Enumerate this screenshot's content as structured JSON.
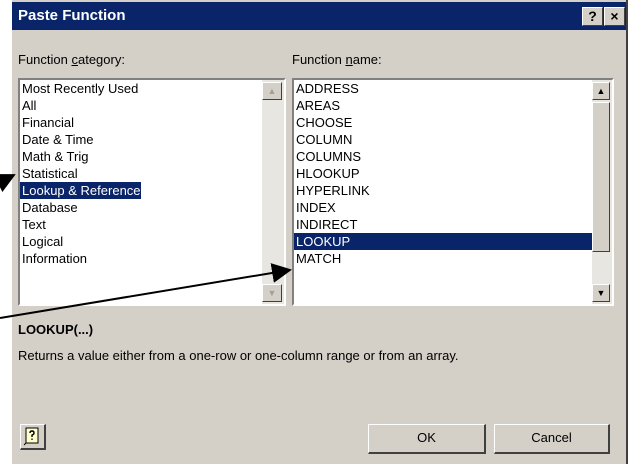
{
  "window": {
    "title": "Paste Function"
  },
  "title_buttons": {
    "help": "?",
    "close": "×"
  },
  "category": {
    "label_prefix": "Function ",
    "label_accel": "c",
    "label_suffix": "ategory:",
    "items": [
      "Most Recently Used",
      "All",
      "Financial",
      "Date & Time",
      "Math & Trig",
      "Statistical",
      "Lookup & Reference",
      "Database",
      "Text",
      "Logical",
      "Information"
    ],
    "selected": "Lookup & Reference"
  },
  "function_name": {
    "label_prefix": "Function ",
    "label_accel": "n",
    "label_suffix": "ame:",
    "items": [
      "ADDRESS",
      "AREAS",
      "CHOOSE",
      "COLUMN",
      "COLUMNS",
      "HLOOKUP",
      "HYPERLINK",
      "INDEX",
      "INDIRECT",
      "LOOKUP",
      "MATCH"
    ],
    "selected": "LOOKUP"
  },
  "selected_function": {
    "signature": "LOOKUP(...)",
    "description": "Returns a value either from a one-row or one-column range or from an array."
  },
  "buttons": {
    "ok": "OK",
    "cancel": "Cancel"
  },
  "colors": {
    "titlebar": "#0a246a",
    "selection": "#0a246a",
    "dialog": "#d4d0c8"
  },
  "icons": {
    "office_help": "office-assistant-help-icon"
  }
}
